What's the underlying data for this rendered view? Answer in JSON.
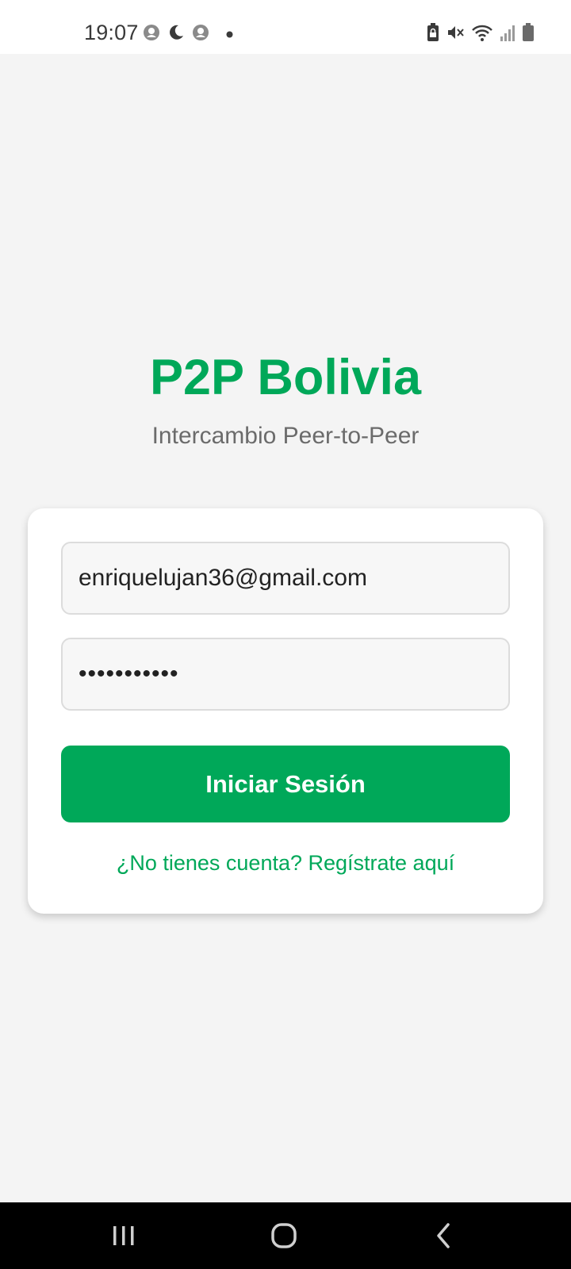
{
  "status_bar": {
    "time": "19:07",
    "left_icons": [
      "profile-circle-icon",
      "moon-icon",
      "profile-circle-icon",
      "dot-icon"
    ],
    "right_icons": [
      "lock-battery-icon",
      "mute-icon",
      "wifi-icon",
      "signal-icon",
      "battery-icon"
    ]
  },
  "header": {
    "title": "P2P Bolivia",
    "subtitle": "Intercambio Peer-to-Peer"
  },
  "login_form": {
    "email_value": "enriquelujan36@gmail.com",
    "password_value": "•••••••••••",
    "submit_label": "Iniciar Sesión",
    "register_link": "¿No tienes cuenta? Regístrate aquí"
  },
  "nav_bar": {
    "buttons": [
      "recent-apps-icon",
      "home-icon",
      "back-icon"
    ]
  },
  "colors": {
    "accent": "#00a859",
    "background": "#f4f4f4",
    "card": "#ffffff",
    "subtitle_text": "#6b6b6b"
  }
}
